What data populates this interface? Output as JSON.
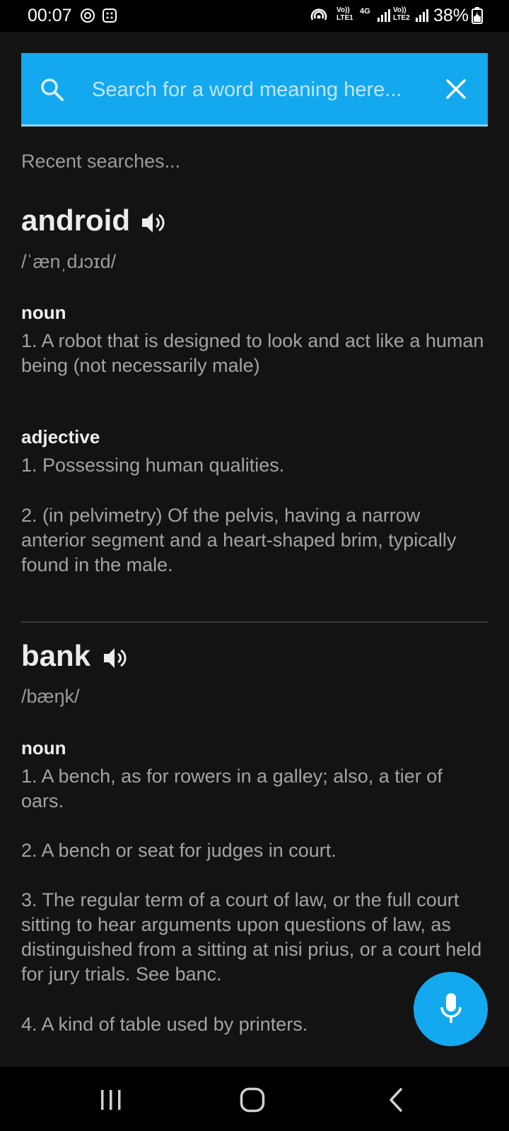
{
  "status": {
    "time": "00:07",
    "network1": "Vo)) LTE1",
    "network_type": "4G",
    "network2": "Vo)) LTE2",
    "battery": "38%"
  },
  "search": {
    "placeholder": "Search for a word meaning here..."
  },
  "recent_label": "Recent searches...",
  "entries": [
    {
      "word": "android",
      "phonetic": "/ˈænˌdɹɔɪd/",
      "sections": [
        {
          "pos": "noun",
          "defs": [
            "1. A robot that is designed to look and act like a human being (not necessarily male)"
          ]
        },
        {
          "pos": "adjective",
          "defs": [
            "1. Possessing human qualities.",
            "2. (in pelvimetry) Of the pelvis, having a narrow anterior segment and a heart-shaped brim, typically found in the male."
          ]
        }
      ]
    },
    {
      "word": "bank",
      "phonetic": "/bæŋk/",
      "sections": [
        {
          "pos": "noun",
          "defs": [
            "1. A bench, as for rowers in a galley; also, a tier of oars.",
            "2. A bench or seat for judges in court.",
            "3. The regular term of a court of law, or the full court sitting to hear arguments upon questions of law, as distinguished from a sitting at nisi prius, or a court held for jury trials. See banc.",
            "4. A kind of table used by printers."
          ]
        }
      ]
    }
  ],
  "icons": {
    "search": "search-icon",
    "clear": "close-icon",
    "speaker": "speaker-icon",
    "mic": "microphone-icon",
    "recents": "recents-icon",
    "home": "home-icon",
    "back": "back-icon"
  },
  "colors": {
    "accent": "#14a9ee",
    "background": "#131313"
  }
}
